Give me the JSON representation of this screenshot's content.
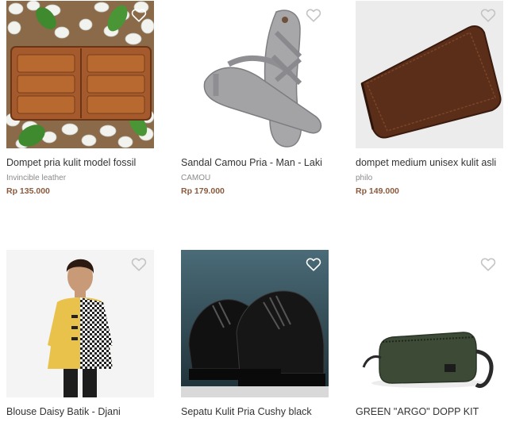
{
  "products": [
    {
      "name": "Dompet pria kulit model fossil",
      "shop": "Invincible leather",
      "price": "Rp 135.000",
      "image_icon": "brown-leather-wallet-on-stones-image"
    },
    {
      "name": "Sandal Camou Pria - Man - Laki",
      "shop": "CAMOU",
      "price": "Rp 179.000",
      "image_icon": "grey-sandal-image"
    },
    {
      "name": "dompet medium unisex kulit asli",
      "shop": "philo",
      "price": "Rp 149.000",
      "image_icon": "dark-brown-long-wallet-image"
    },
    {
      "name": "Blouse Daisy Batik - Djani",
      "shop": "",
      "price": "",
      "image_icon": "batik-blouse-model-image"
    },
    {
      "name": "Sepatu Kulit Pria Cushy black",
      "shop": "",
      "price": "",
      "image_icon": "black-leather-shoes-image"
    },
    {
      "name": "GREEN \"ARGO\" DOPP KIT",
      "shop": "",
      "price": "",
      "image_icon": "green-dopp-kit-pouch-image"
    }
  ],
  "icons": {
    "favorite": "heart-outline-icon"
  },
  "colors": {
    "price": "#8b5a3c",
    "shop": "#8a8a8a",
    "name": "#333333"
  }
}
